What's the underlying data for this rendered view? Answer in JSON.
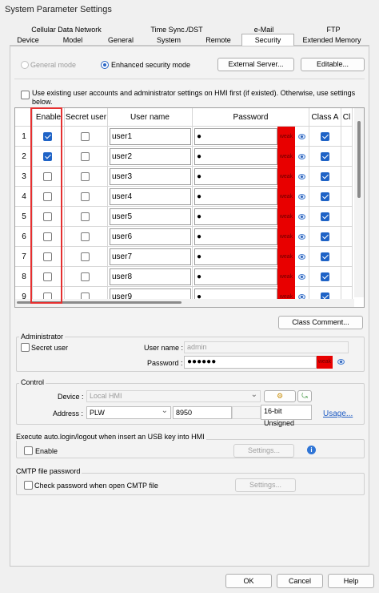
{
  "window": {
    "title": "System Parameter Settings"
  },
  "tabs": {
    "row1": [
      "Cellular Data Network",
      "Time Sync./DST",
      "e-Mail",
      "FTP"
    ],
    "row2": [
      "Device",
      "Model",
      "General",
      "System",
      "Remote",
      "Security",
      "Extended Memory"
    ],
    "active": "Security"
  },
  "mode": {
    "general": "General mode",
    "enhanced": "Enhanced security mode",
    "external_server": "External Server...",
    "editable": "Editable..."
  },
  "use_existing": {
    "label_line1": "Use existing user accounts and administrator settings on HMI first (if existed). Otherwise, use settings",
    "label_line2": "below.",
    "checked": false
  },
  "user_table": {
    "headers": [
      "Enable",
      "Secret user",
      "User name",
      "Password",
      "Class A",
      "Cl"
    ],
    "rows": [
      {
        "num": "1",
        "enable": true,
        "secret": false,
        "name": "user1",
        "password": "●",
        "strength": "weak",
        "classA": true
      },
      {
        "num": "2",
        "enable": true,
        "secret": false,
        "name": "user2",
        "password": "●",
        "strength": "weak",
        "classA": true
      },
      {
        "num": "3",
        "enable": false,
        "secret": false,
        "name": "user3",
        "password": "●",
        "strength": "weak",
        "classA": true
      },
      {
        "num": "4",
        "enable": false,
        "secret": false,
        "name": "user4",
        "password": "●",
        "strength": "weak",
        "classA": true
      },
      {
        "num": "5",
        "enable": false,
        "secret": false,
        "name": "user5",
        "password": "●",
        "strength": "weak",
        "classA": true
      },
      {
        "num": "6",
        "enable": false,
        "secret": false,
        "name": "user6",
        "password": "●",
        "strength": "weak",
        "classA": true
      },
      {
        "num": "7",
        "enable": false,
        "secret": false,
        "name": "user7",
        "password": "●",
        "strength": "weak",
        "classA": true
      },
      {
        "num": "8",
        "enable": false,
        "secret": false,
        "name": "user8",
        "password": "●",
        "strength": "weak",
        "classA": true
      },
      {
        "num": "9",
        "enable": false,
        "secret": false,
        "name": "user9",
        "password": "●",
        "strength": "weak",
        "classA": true
      }
    ]
  },
  "class_comment": "Class Comment...",
  "administrator": {
    "group": "Administrator",
    "secret_user": "Secret user",
    "user_name_label": "User name :",
    "user_name_value": "admin",
    "password_label": "Password :",
    "password_value": "●●●●●●",
    "strength": "weak"
  },
  "control": {
    "group": "Control",
    "device_label": "Device :",
    "device_value": "Local HMI",
    "address_label": "Address :",
    "address_value": "PLW",
    "address_number": "8950",
    "data_type": "16-bit Unsigned",
    "usage": "Usage..."
  },
  "usb_login": {
    "group": "Execute auto.login/logout when insert an USB key into HMI",
    "enable": "Enable",
    "settings": "Settings..."
  },
  "cmtp": {
    "group": "CMTP file password",
    "check_label": "Check password when open CMTP file",
    "settings": "Settings..."
  },
  "footer": {
    "ok": "OK",
    "cancel": "Cancel",
    "help": "Help"
  },
  "colors": {
    "weak": "#e80000",
    "accent": "#1f63c6",
    "highlight_frame": "#e53030"
  }
}
